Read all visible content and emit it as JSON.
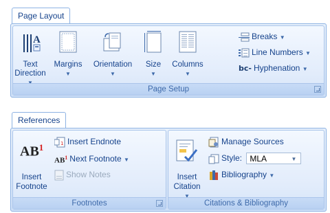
{
  "page_layout": {
    "tab_label": "Page Layout",
    "group_label": "Page Setup",
    "buttons": [
      {
        "line1": "Text",
        "line2": "Direction",
        "dropdown": true,
        "icon": "text-direction-icon"
      },
      {
        "line1": "Margins",
        "line2": "",
        "dropdown": true,
        "icon": "margins-icon"
      },
      {
        "line1": "Orientation",
        "line2": "",
        "dropdown": true,
        "icon": "orientation-icon"
      },
      {
        "line1": "Size",
        "line2": "",
        "dropdown": true,
        "icon": "size-icon"
      },
      {
        "line1": "Columns",
        "line2": "",
        "dropdown": true,
        "icon": "columns-icon"
      }
    ],
    "small_buttons": [
      {
        "label": "Breaks",
        "icon": "breaks-icon"
      },
      {
        "label": "Line Numbers",
        "icon": "line-numbers-icon"
      },
      {
        "label": "Hyphenation",
        "icon": "hyphenation-icon",
        "glyph": "bc-"
      }
    ]
  },
  "references": {
    "tab_label": "References",
    "footnotes": {
      "group_label": "Footnotes",
      "insert_footnote": {
        "line1": "Insert",
        "line2": "Footnote",
        "glyph": "AB",
        "sup": "1"
      },
      "insert_endnote": "Insert Endnote",
      "next_footnote": "Next Footnote",
      "show_notes": "Show Notes",
      "next_glyph": "AB",
      "next_sup": "1"
    },
    "citations": {
      "group_label": "Citations & Bibliography",
      "insert_citation": {
        "line1": "Insert",
        "line2": "Citation"
      },
      "manage_sources": "Manage Sources",
      "style_label": "Style:",
      "style_value": "MLA",
      "bibliography": "Bibliography"
    }
  },
  "colors": {
    "accent": "#15428b",
    "border": "#8db2e3",
    "group_label_bg": "#c7dbf6"
  }
}
